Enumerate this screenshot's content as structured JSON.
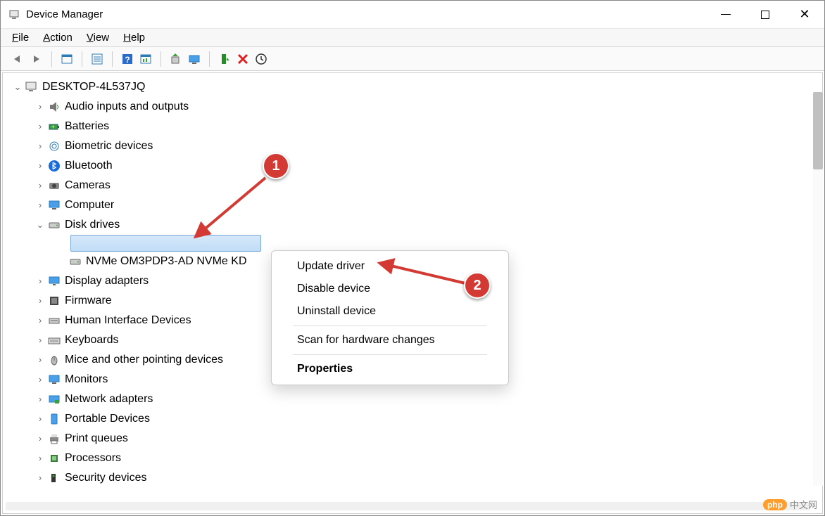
{
  "window": {
    "title": "Device Manager"
  },
  "menu": {
    "file": "File",
    "action": "Action",
    "view": "View",
    "help": "Help"
  },
  "toolbar_icons": [
    "back",
    "forward",
    "show-menu",
    "details",
    "help",
    "properties",
    "update",
    "monitor",
    "enable",
    "remove",
    "scan"
  ],
  "tree": {
    "root": "DESKTOP-4L537JQ",
    "items": [
      {
        "label": "Audio inputs and outputs",
        "icon": "audio"
      },
      {
        "label": "Batteries",
        "icon": "battery"
      },
      {
        "label": "Biometric devices",
        "icon": "biometric"
      },
      {
        "label": "Bluetooth",
        "icon": "bluetooth"
      },
      {
        "label": "Cameras",
        "icon": "camera"
      },
      {
        "label": "Computer",
        "icon": "computer"
      },
      {
        "label": "Disk drives",
        "icon": "disk",
        "expanded": true,
        "children": [
          {
            "label": "",
            "selected": true
          },
          {
            "label": "NVMe OM3PDP3-AD NVMe KD",
            "icon": "disk"
          }
        ]
      },
      {
        "label": "Display adapters",
        "icon": "display"
      },
      {
        "label": "Firmware",
        "icon": "firmware"
      },
      {
        "label": "Human Interface Devices",
        "icon": "hid"
      },
      {
        "label": "Keyboards",
        "icon": "keyboard"
      },
      {
        "label": "Mice and other pointing devices",
        "icon": "mouse"
      },
      {
        "label": "Monitors",
        "icon": "monitor"
      },
      {
        "label": "Network adapters",
        "icon": "network"
      },
      {
        "label": "Portable Devices",
        "icon": "portable"
      },
      {
        "label": "Print queues",
        "icon": "printer"
      },
      {
        "label": "Processors",
        "icon": "cpu"
      },
      {
        "label": "Security devices",
        "icon": "security"
      }
    ]
  },
  "context_menu": {
    "update": "Update driver",
    "disable": "Disable device",
    "uninstall": "Uninstall device",
    "scan": "Scan for hardware changes",
    "properties": "Properties"
  },
  "callouts": {
    "one": "1",
    "two": "2"
  },
  "watermark": {
    "badge": "php",
    "text": "中文网"
  }
}
